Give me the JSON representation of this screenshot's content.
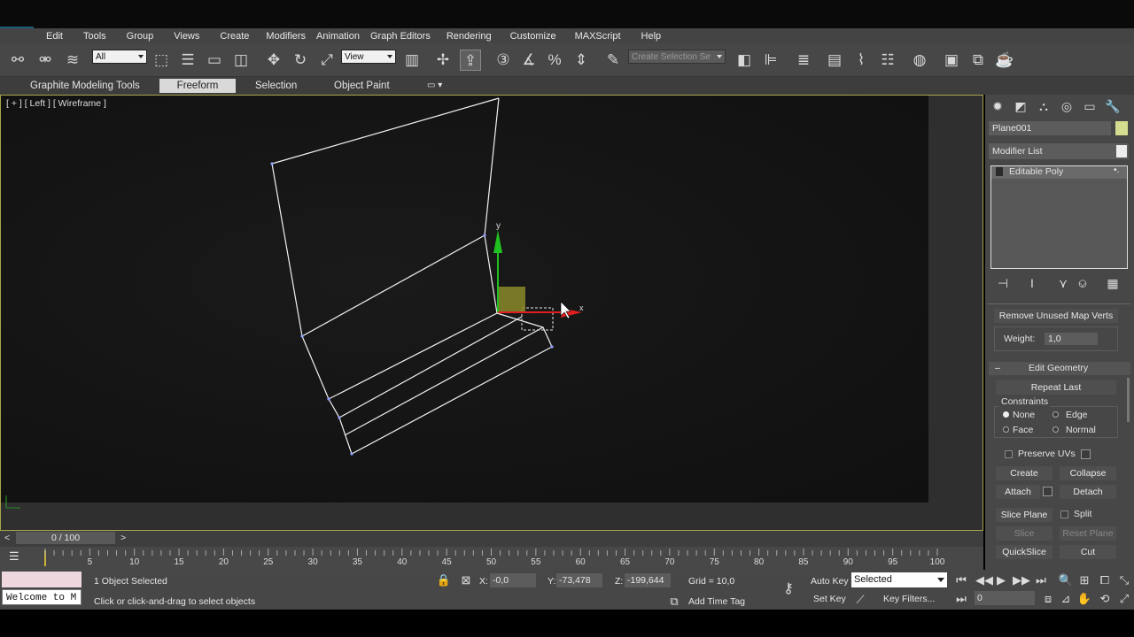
{
  "menu": [
    "Edit",
    "Tools",
    "Group",
    "Views",
    "Create",
    "Modifiers",
    "Animation",
    "Graph Editors",
    "Rendering",
    "Customize",
    "MAXScript",
    "Help"
  ],
  "toolbar": {
    "selection_filter": "All",
    "reference_coord": "View",
    "named_selection": "Create Selection Se"
  },
  "ribbon": {
    "tabs": [
      "Graphite Modeling Tools",
      "Freeform",
      "Selection",
      "Object Paint"
    ],
    "active_tab": "Freeform"
  },
  "viewport": {
    "label": "[ + ] [ Left ] [ Wireframe ]",
    "gizmo_y_label": "y",
    "gizmo_x_label": "x"
  },
  "command_panel": {
    "object_name": "Plane001",
    "object_color": "#d6dc8f",
    "modifier_list": "Modifier List",
    "stack_item": "Editable Poly",
    "remove_unused": "Remove Unused Map Verts",
    "weight_label": "Weight:",
    "weight_value": "1,0",
    "rollout_title": "Edit Geometry",
    "repeat_last": "Repeat Last",
    "constraints_label": "Constraints",
    "constraints": {
      "none": "None",
      "edge": "Edge",
      "face": "Face",
      "normal": "Normal"
    },
    "preserve_uvs": "Preserve UVs",
    "create": "Create",
    "collapse": "Collapse",
    "attach": "Attach",
    "detach": "Detach",
    "slice_plane": "Slice Plane",
    "split": "Split",
    "slice": "Slice",
    "reset_plane": "Reset Plane",
    "quickslice": "QuickSlice",
    "cut": "Cut"
  },
  "timeline": {
    "frame_display": "0 / 100",
    "ticks": [
      "5",
      "10",
      "15",
      "20",
      "25",
      "30",
      "35",
      "40",
      "45",
      "50",
      "55",
      "60",
      "65",
      "70",
      "75",
      "80",
      "85",
      "90",
      "95",
      "100"
    ]
  },
  "status": {
    "listener": "Welcome to M",
    "selected_count": "1 Object Selected",
    "prompt": "Click or click-and-drag to select objects",
    "x_label": "X:",
    "x_value": "-0,0",
    "y_label": "Y:",
    "y_value": "-73,478",
    "z_label": "Z:",
    "z_value": "-199,644",
    "grid": "Grid = 10,0",
    "add_time_tag": "Add Time Tag",
    "auto_key": "Auto Key",
    "key_mode": "Selected",
    "set_key": "Set Key",
    "key_filters": "Key Filters...",
    "current_frame": "0"
  },
  "colors": {
    "viewport_border": "#a9a54a",
    "gizmo_x": "#e02020",
    "gizmo_y": "#20c020",
    "gizmo_plane": "#8a8a2a"
  }
}
